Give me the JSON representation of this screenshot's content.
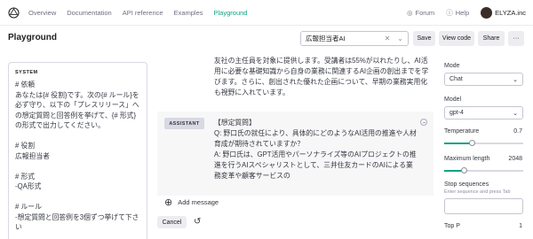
{
  "nav": {
    "links": [
      "Overview",
      "Documentation",
      "API reference",
      "Examples",
      "Playground"
    ],
    "active": "Playground",
    "forum": "Forum",
    "help": "Help",
    "org": "ELYZA.inc"
  },
  "header": {
    "title": "Playground",
    "preset_value": "広報担当者AI",
    "save": "Save",
    "view_code": "View code",
    "share": "Share",
    "more": "···"
  },
  "system": {
    "label": "SYSTEM",
    "text": "# 依頼\nあなたは{# 役割}です。次の{# ルール}を必ず守り、以下の「プレスリリース」への想定質問と回答例を挙げて、{# 形式}の形式で出力してください。\n\n# 役割\n広報担当者\n\n# 形式\n-QA形式\n\n# ルール\n-想定質問と回答例を3個ずつ挙げて下さい"
  },
  "conversation": {
    "user_text": "友社の主任員を対象に提供します。受講者は55%が以れたりし、AI活用に必要な基礎知識から自身の業務に関連するAI企画の創出までを学びます。さらに、創出された優れた企画について、早期の業務実用化も視野に入れています。",
    "assistant_role": "ASSISTANT",
    "assistant_text": "【想定質問】\nQ: 野口氏の就任により、具体的にどのようなAI活用の推進や人材育成が期待されていますか？\nA: 野口氏は、GPT活用やパーソナライズ等のAIプロジェクトの推進を行うAIスペシャリストとして、三井住友カードのAIによる業務変革や顧客サービスの",
    "add_message": "Add message",
    "cancel": "Cancel"
  },
  "settings": {
    "mode_label": "Mode",
    "mode_value": "Chat",
    "model_label": "Model",
    "model_value": "gpt-4",
    "temperature_label": "Temperature",
    "temperature_value": "0.7",
    "temperature_fraction": 0.35,
    "max_length_label": "Maximum length",
    "max_length_value": "2048",
    "max_length_fraction": 0.25,
    "stop_label": "Stop sequences",
    "stop_placeholder": "Enter sequence and press Tab",
    "top_p_label": "Top P",
    "top_p_value": "1"
  },
  "colors": {
    "accent": "#10a37f",
    "border": "#c5c5d2"
  }
}
